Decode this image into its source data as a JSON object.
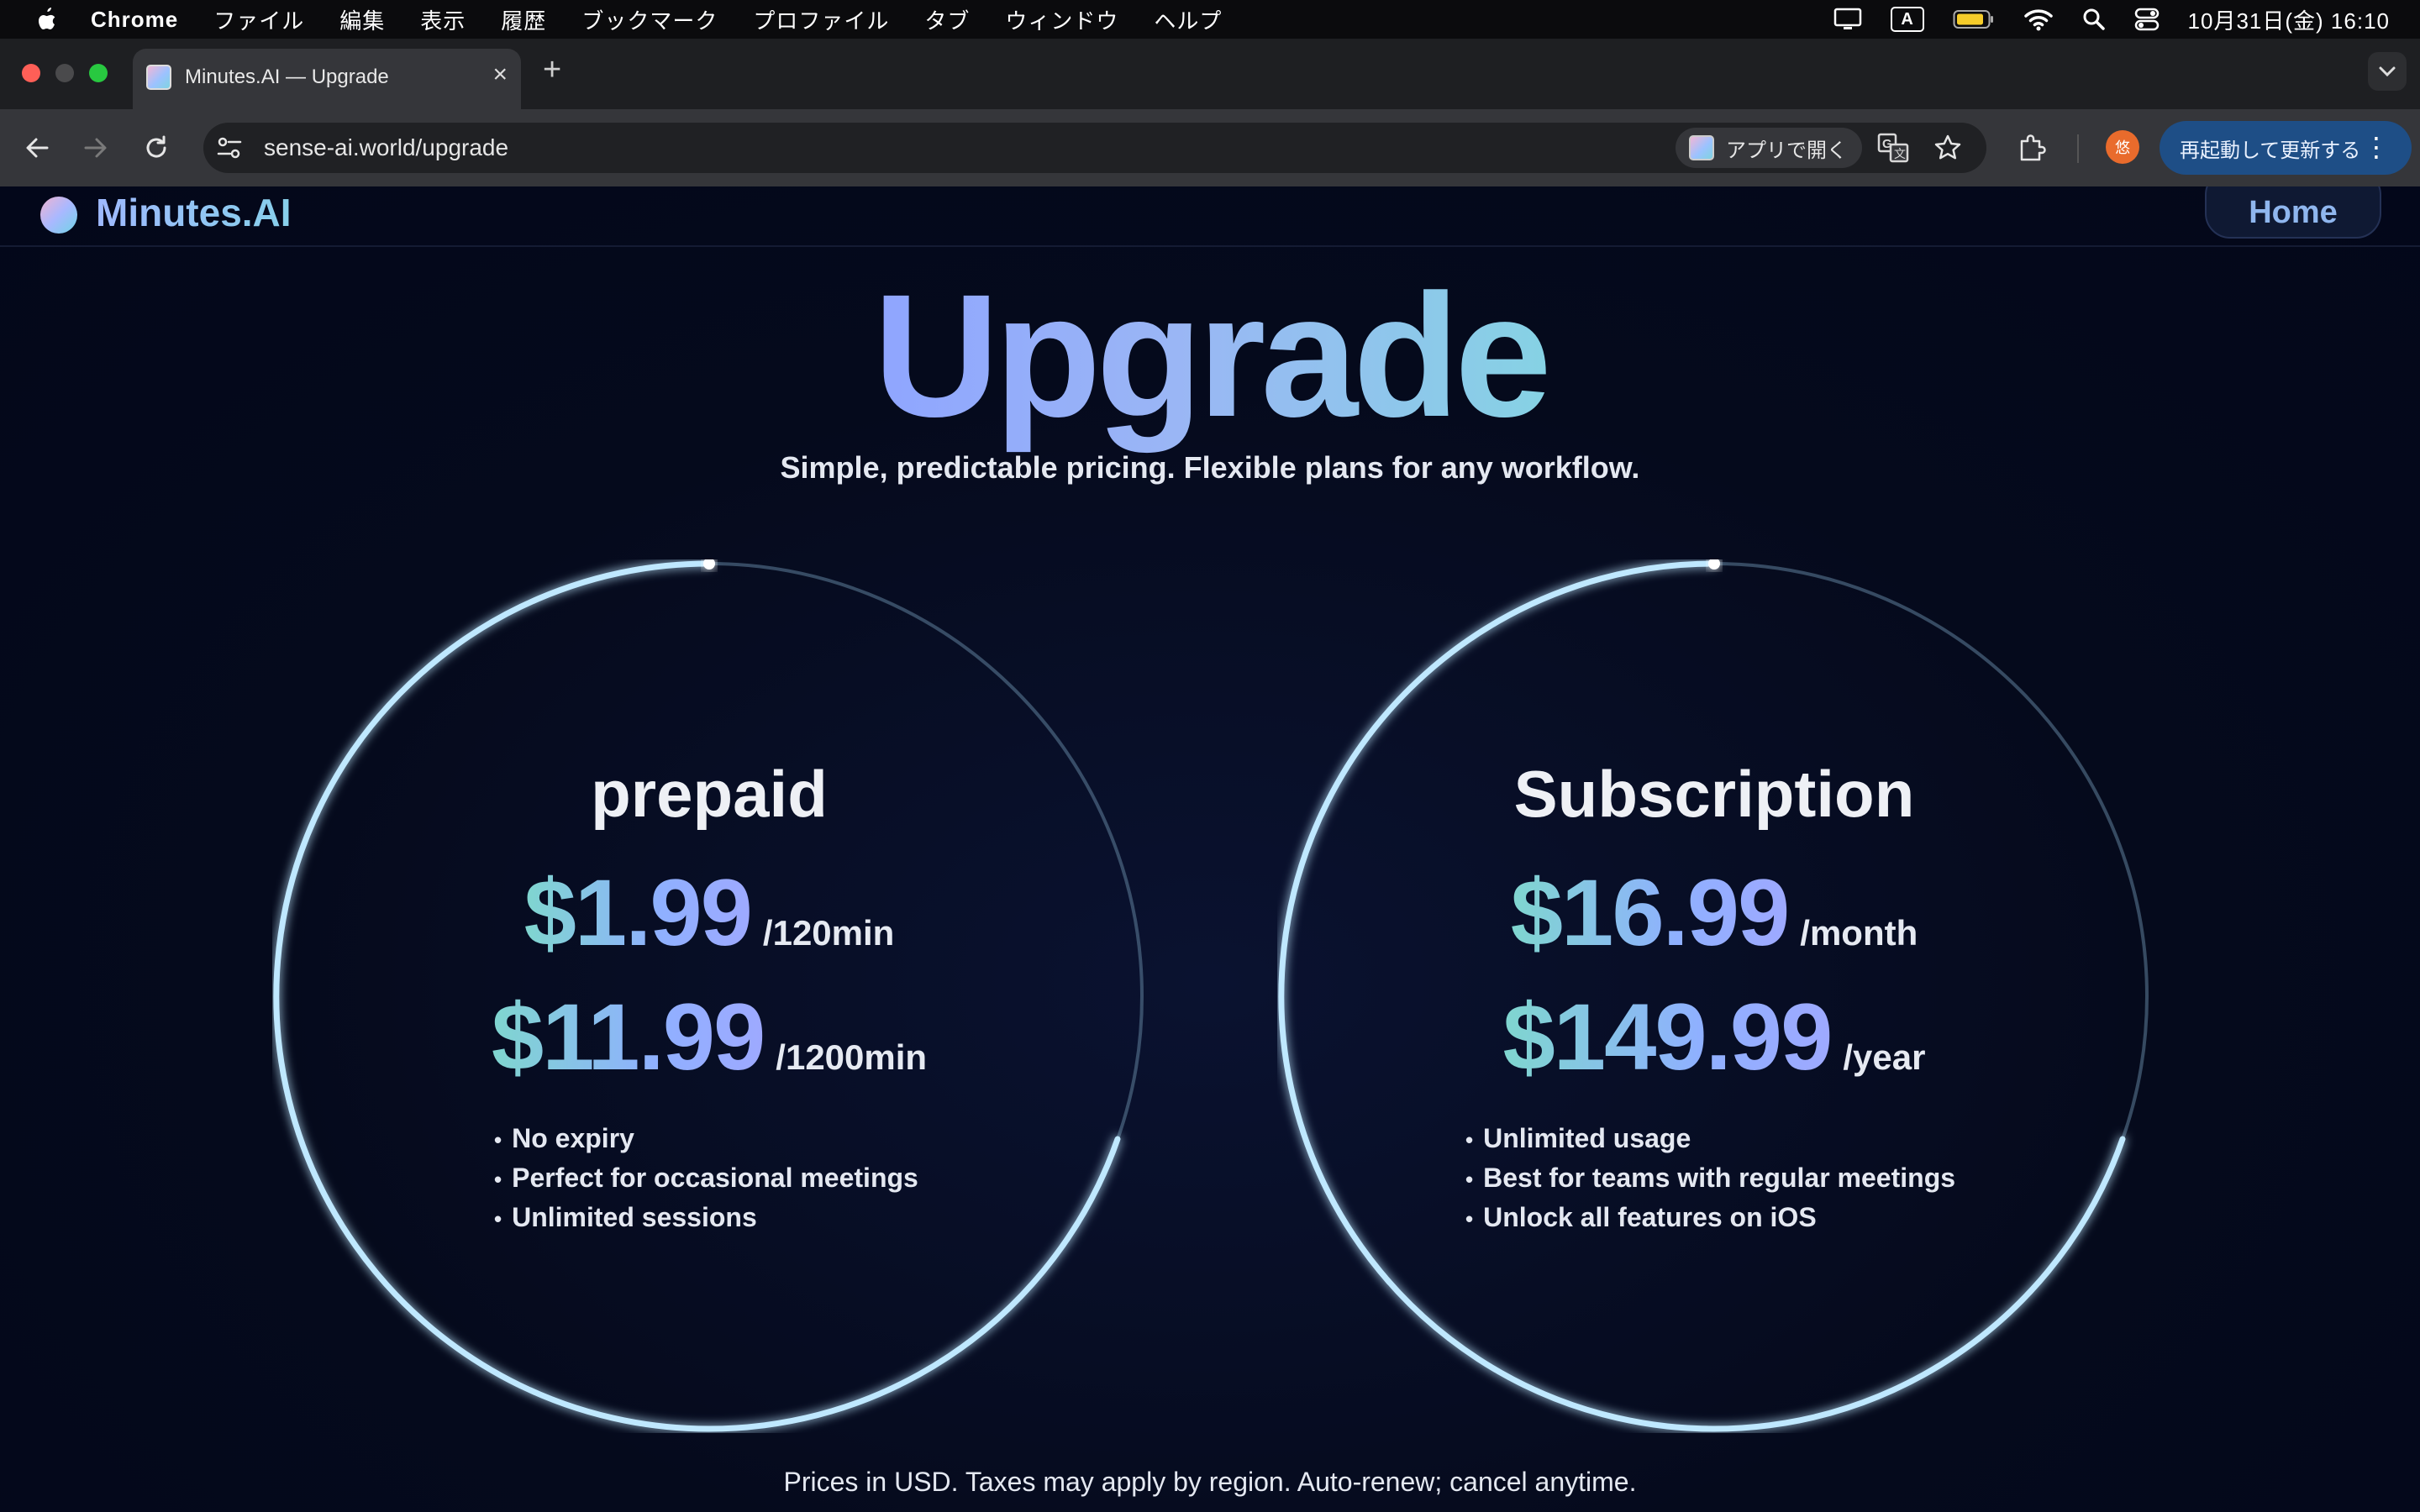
{
  "menubar": {
    "app_name": "Chrome",
    "items": [
      "ファイル",
      "編集",
      "表示",
      "履歴",
      "ブックマーク",
      "プロファイル",
      "タブ",
      "ウィンドウ",
      "ヘルプ"
    ],
    "input_mode": "A",
    "clock": "10月31日(金)  16:10"
  },
  "browser": {
    "tab_title": "Minutes.AI — Upgrade",
    "url": "sense-ai.world/upgrade",
    "open_in_app": "アプリで開く",
    "profile_initial": "悠",
    "relaunch_label": "再起動して更新する"
  },
  "site": {
    "logo_text": "Minutes.AI",
    "home_label": "Home"
  },
  "page": {
    "title": "Upgrade",
    "subtitle": "Simple, predictable pricing. Flexible plans for any workflow.",
    "footer_note": "Prices in USD. Taxes may apply by region. Auto-renew; cancel anytime."
  },
  "plans": [
    {
      "name": "prepaid",
      "prices": [
        {
          "amount": "$1.99",
          "unit": "/120min"
        },
        {
          "amount": "$11.99",
          "unit": "/1200min"
        }
      ],
      "features": [
        "No expiry",
        "Perfect for occasional meetings",
        "Unlimited sessions"
      ]
    },
    {
      "name": "Subscription",
      "prices": [
        {
          "amount": "$16.99",
          "unit": "/month"
        },
        {
          "amount": "$149.99",
          "unit": "/year"
        }
      ],
      "features": [
        "Unlimited usage",
        "Best for teams with regular meetings",
        "Unlock all features on iOS"
      ]
    }
  ],
  "colors": {
    "page_background": "#04081a",
    "accent_blue": "#8fa5ff",
    "accent_teal": "#7fd6cf",
    "ring_glow": "#bfe8ff",
    "relaunch_button": "#1e4e86"
  }
}
